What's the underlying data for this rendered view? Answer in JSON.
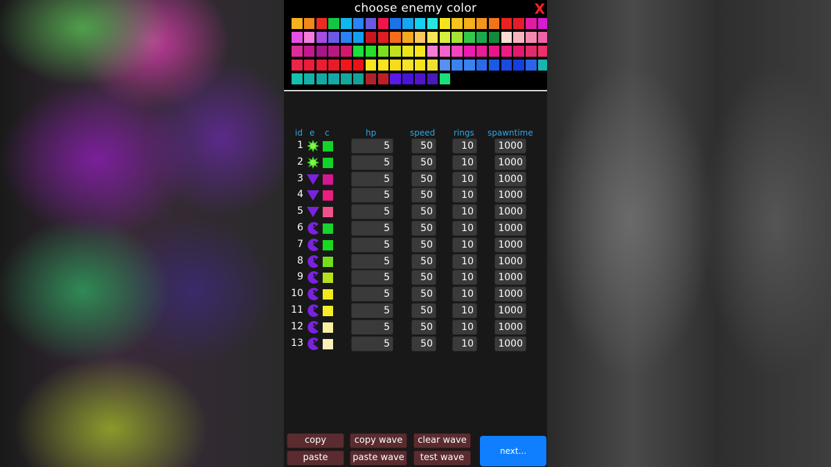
{
  "title": "choose enemy color",
  "close_label": "X",
  "palette": [
    "#f6b11c",
    "#f08a1b",
    "#ec2c21",
    "#12c746",
    "#0fb8e8",
    "#2a85f2",
    "#6a5ae0",
    "#f0164c",
    "#1a73e8",
    "#17a6f0",
    "#14d0f2",
    "#27e6e0",
    "#f5e41c",
    "#f6c41a",
    "#f5b01a",
    "#f4941a",
    "#f2741a",
    "#ec2221",
    "#e51c2c",
    "#e01ca4",
    "#d81cd0",
    "#e650e6",
    "#f57cdc",
    "#a84ce6",
    "#6a5ae6",
    "#2a82f2",
    "#14a0f0",
    "#c8161e",
    "#e01c24",
    "#f46c1c",
    "#f6a81c",
    "#f8c85a",
    "#f6e654",
    "#d8ee3e",
    "#a6e434",
    "#34c84a",
    "#1aa84c",
    "#128a3a",
    "#fadcd6",
    "#f8b4c0",
    "#f48ab0",
    "#f062a8",
    "#dc2c9a",
    "#c4188c",
    "#a6148a",
    "#b81882",
    "#d4186c",
    "#1ae03c",
    "#24e02a",
    "#7ae01c",
    "#c0e21c",
    "#ece41c",
    "#f6e61c",
    "#f47cd4",
    "#f462cc",
    "#f444c0",
    "#ec1cb0",
    "#e81c94",
    "#e6168a",
    "#ec1c84",
    "#e4186c",
    "#e02a6c",
    "#ec3068",
    "#ea244c",
    "#ec1c3c",
    "#ec1c34",
    "#e81c28",
    "#f0161c",
    "#e81418",
    "#f6e81c",
    "#f8e41c",
    "#f6dc1c",
    "#f6e22a",
    "#f2e41c",
    "#f0e034",
    "#5a8ef0",
    "#3a82f0",
    "#3a82f0",
    "#2a6ae8",
    "#1a5ae6",
    "#1a4ae0",
    "#163ee0",
    "#2a64e8",
    "#1ab4b0",
    "#14c0b0",
    "#12b2a8",
    "#14a8a0",
    "#14a8a8",
    "#14a89c",
    "#13a294",
    "#b02228",
    "#c01e26",
    "#5a1ae6",
    "#4a14d4",
    "#5014cc",
    "#481ab8",
    "#1ae07a"
  ],
  "headers": {
    "id": "id",
    "e": "e",
    "c": "c",
    "hp": "hp",
    "speed": "speed",
    "rings": "rings",
    "spawntime": "spawntime"
  },
  "rows": [
    {
      "id": "1",
      "enemy": "green-splat-icon",
      "color": "#12d428",
      "hp": "5",
      "speed": "50",
      "rings": "10",
      "spawntime": "1000"
    },
    {
      "id": "2",
      "enemy": "green-splat-icon",
      "color": "#12d428",
      "hp": "5",
      "speed": "50",
      "rings": "10",
      "spawntime": "1000"
    },
    {
      "id": "3",
      "enemy": "purple-triangle-icon",
      "color": "#d41890",
      "hp": "5",
      "speed": "50",
      "rings": "10",
      "spawntime": "1000"
    },
    {
      "id": "4",
      "enemy": "purple-triangle-icon",
      "color": "#ec1c80",
      "hp": "5",
      "speed": "50",
      "rings": "10",
      "spawntime": "1000"
    },
    {
      "id": "5",
      "enemy": "purple-triangle-icon",
      "color": "#f0508c",
      "hp": "5",
      "speed": "50",
      "rings": "10",
      "spawntime": "1000"
    },
    {
      "id": "6",
      "enemy": "purple-pacman-icon",
      "color": "#16d42c",
      "hp": "5",
      "speed": "50",
      "rings": "10",
      "spawntime": "1000"
    },
    {
      "id": "7",
      "enemy": "purple-pacman-icon",
      "color": "#18d820",
      "hp": "5",
      "speed": "50",
      "rings": "10",
      "spawntime": "1000"
    },
    {
      "id": "8",
      "enemy": "purple-pacman-icon",
      "color": "#74de1c",
      "hp": "5",
      "speed": "50",
      "rings": "10",
      "spawntime": "1000"
    },
    {
      "id": "9",
      "enemy": "purple-pacman-icon",
      "color": "#b8e01c",
      "hp": "5",
      "speed": "50",
      "rings": "10",
      "spawntime": "1000"
    },
    {
      "id": "10",
      "enemy": "purple-pacman-icon",
      "color": "#f2e81c",
      "hp": "5",
      "speed": "50",
      "rings": "10",
      "spawntime": "1000"
    },
    {
      "id": "11",
      "enemy": "purple-pacman-icon",
      "color": "#f6ec2a",
      "hp": "5",
      "speed": "50",
      "rings": "10",
      "spawntime": "1000"
    },
    {
      "id": "12",
      "enemy": "purple-pacman-icon",
      "color": "#f8f0a0",
      "hp": "5",
      "speed": "50",
      "rings": "10",
      "spawntime": "1000"
    },
    {
      "id": "13",
      "enemy": "purple-pacman-icon",
      "color": "#faf0b8",
      "hp": "5",
      "speed": "50",
      "rings": "10",
      "spawntime": "1000"
    }
  ],
  "buttons": {
    "copy": "copy",
    "paste": "paste",
    "copy_wave": "copy wave",
    "paste_wave": "paste wave",
    "clear_wave": "clear wave",
    "test_wave": "test wave",
    "next": "next..."
  },
  "colors": {
    "header_text": "#2fa6ea",
    "close": "#ff2020",
    "button": "#5a2c30",
    "next_button": "#0f7fff"
  }
}
